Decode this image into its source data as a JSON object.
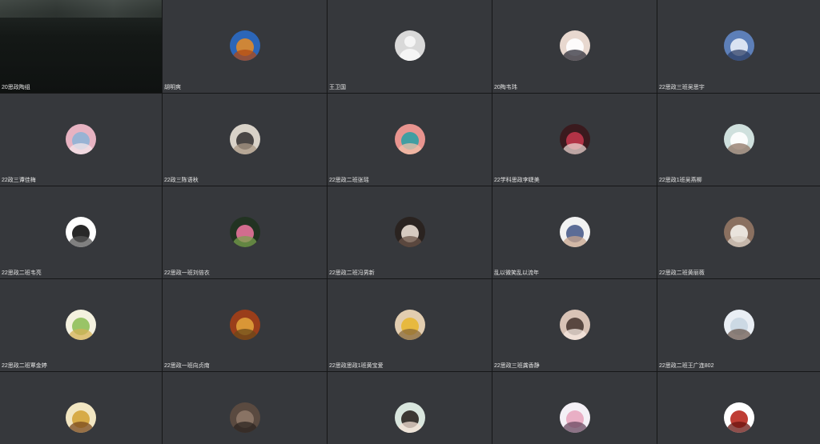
{
  "participants": [
    {
      "name": "20思政陶组",
      "avatar": "camera-video-feed",
      "video": true,
      "colors": [
        "#1a1f1d",
        "#2e3531"
      ]
    },
    {
      "name": "胡明爽",
      "avatar": "autumn-tree-lake-avatar",
      "video": false,
      "colors": [
        "#2c66b8",
        "#e08a2a",
        "#b04a14"
      ]
    },
    {
      "name": "王卫国",
      "avatar": "default-person-avatar",
      "video": false,
      "colors": [
        "#d9d9d9",
        "#f5f5f5",
        "#bdbdbd"
      ]
    },
    {
      "name": "20陶韦玮",
      "avatar": "cat-face-avatar",
      "video": false,
      "colors": [
        "#e8d8cf",
        "#ffffff",
        "#2f2f3a"
      ]
    },
    {
      "name": "22思政三班吴思宇",
      "avatar": "blue-cartoon-avatar",
      "video": false,
      "colors": [
        "#5d7fb8",
        "#e8eef8",
        "#2d3f66"
      ]
    },
    {
      "name": "22政三谭佳梅",
      "avatar": "pink-sky-sea-avatar",
      "video": false,
      "colors": [
        "#e7b3c2",
        "#8fb3d6",
        "#f4e6ea"
      ]
    },
    {
      "name": "22政三陈语秋",
      "avatar": "anime-character-avatar",
      "video": false,
      "colors": [
        "#d9d2c8",
        "#3a3636",
        "#a99886"
      ]
    },
    {
      "name": "22思政二班张瑶",
      "avatar": "patrick-star-avatar",
      "video": false,
      "colors": [
        "#e8948f",
        "#2f9fa4",
        "#f2c0a8"
      ]
    },
    {
      "name": "22学科思政李婕美",
      "avatar": "lotso-bear-avatar",
      "video": false,
      "colors": [
        "#3a1a1e",
        "#c0364a",
        "#ead6d2"
      ]
    },
    {
      "name": "22思政1班吴燕柳",
      "avatar": "white-cat-avatar",
      "video": false,
      "colors": [
        "#cfe0dd",
        "#ffffff",
        "#8f7464"
      ]
    },
    {
      "name": "22思政二班韦亮",
      "avatar": "black-fluffy-creature-avatar",
      "video": false,
      "colors": [
        "#ffffff",
        "#111111",
        "#555555"
      ]
    },
    {
      "name": "22思政一班刘倍衣",
      "avatar": "lotus-flower-avatar",
      "video": false,
      "colors": [
        "#223322",
        "#e5739a",
        "#7aa14e"
      ]
    },
    {
      "name": "22思政二班冯男新",
      "avatar": "portrait-girl-dark-avatar",
      "video": false,
      "colors": [
        "#2a2320",
        "#e9ddd2",
        "#6b5448"
      ]
    },
    {
      "name": "乱以微笑乱以流年",
      "avatar": "couple-photo-avatar",
      "video": false,
      "colors": [
        "#f2f2f2",
        "#4a5d8c",
        "#c7a48c"
      ]
    },
    {
      "name": "22思政二班黄丽薇",
      "avatar": "white-puppy-avatar",
      "video": false,
      "colors": [
        "#8a7060",
        "#f3efea",
        "#d8cfc4"
      ]
    },
    {
      "name": "22思政二班覃金婷",
      "avatar": "green-frog-cartoon-avatar",
      "video": false,
      "colors": [
        "#f4f1df",
        "#8fbf5a",
        "#d6b255"
      ]
    },
    {
      "name": "22思政一班向贞南",
      "avatar": "autumn-leaves-avatar",
      "video": false,
      "colors": [
        "#9a3e1a",
        "#e0a03a",
        "#6b4a1a"
      ]
    },
    {
      "name": "22思政思政1班黄宝爱",
      "avatar": "yellow-cartoon-avatar",
      "video": false,
      "colors": [
        "#e2cdb0",
        "#e8b733",
        "#8a6a3a"
      ]
    },
    {
      "name": "22思政三班龚香静",
      "avatar": "portrait-girl-pink-avatar",
      "video": false,
      "colors": [
        "#d9c3b6",
        "#4a3a33",
        "#f5e8e0"
      ]
    },
    {
      "name": "22思政二班王广连802",
      "avatar": "winter-child-avatar",
      "video": false,
      "colors": [
        "#e9eef4",
        "#c9d6e2",
        "#6d5b52"
      ]
    },
    {
      "name": "",
      "avatar": "cartoon-animal-yellow-avatar",
      "video": false,
      "colors": [
        "#f2e6c2",
        "#d4a43a",
        "#7a4a1e"
      ]
    },
    {
      "name": "",
      "avatar": "dark-anime-avatar",
      "video": false,
      "colors": [
        "#5a4a40",
        "#8e7868",
        "#2c2420"
      ]
    },
    {
      "name": "",
      "avatar": "smiling-girl-avatar",
      "video": false,
      "colors": [
        "#d9e6de",
        "#2a2420",
        "#f3e2d6"
      ]
    },
    {
      "name": "",
      "avatar": "cartoon-girl-bow-avatar",
      "video": false,
      "colors": [
        "#f4f0f6",
        "#e8a7c0",
        "#6a4a60"
      ]
    },
    {
      "name": "",
      "avatar": "red-character-avatar",
      "video": false,
      "colors": [
        "#ffffff",
        "#b8281e",
        "#6a1410"
      ]
    }
  ]
}
